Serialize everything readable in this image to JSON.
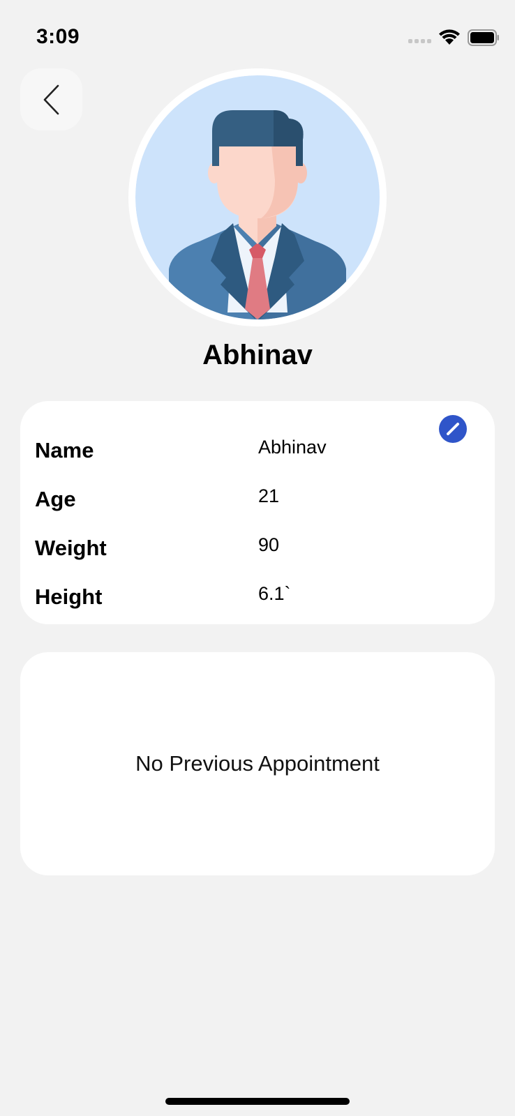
{
  "status_bar": {
    "time": "3:09"
  },
  "profile": {
    "name": "Abhinav"
  },
  "details": {
    "rows": [
      {
        "label": "Name",
        "value": "Abhinav"
      },
      {
        "label": "Age",
        "value": "21"
      },
      {
        "label": "Weight",
        "value": "90"
      },
      {
        "label": "Height",
        "value": "6.1`"
      }
    ]
  },
  "appointments": {
    "empty_text": "No Previous Appointment"
  },
  "icons": {
    "back": "chevron-left-icon",
    "edit": "pencil-icon",
    "wifi": "wifi-icon",
    "battery": "battery-icon",
    "signal": "signal-icon"
  },
  "colors": {
    "background": "#f2f2f2",
    "card": "#ffffff",
    "edit_accent": "#2f55c9",
    "avatar_bg": "#cde3fb"
  }
}
